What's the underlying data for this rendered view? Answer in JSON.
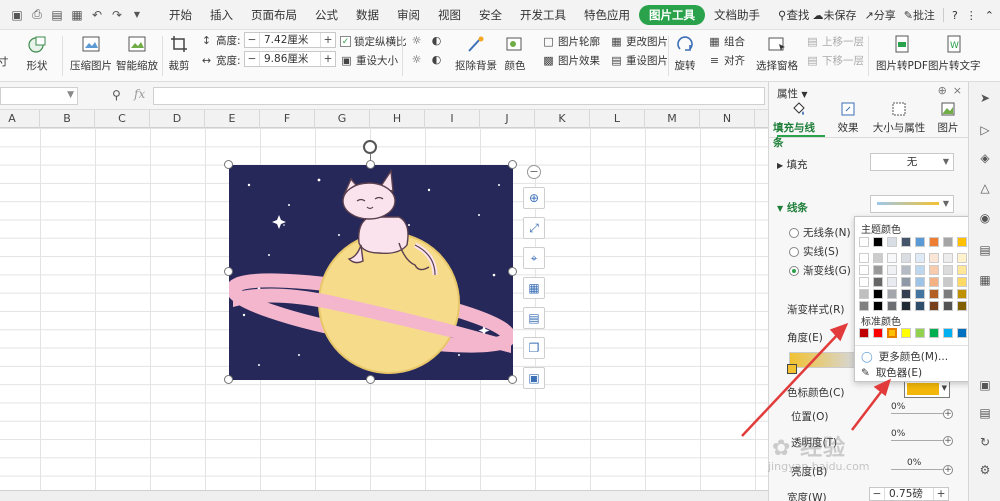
{
  "menubar": {
    "tabs": [
      "开始",
      "插入",
      "页面布局",
      "公式",
      "数据",
      "审阅",
      "视图",
      "安全",
      "开发工具",
      "特色应用",
      "图片工具",
      "文档助手"
    ],
    "active_tab": "图片工具",
    "search": "查找",
    "unsaved": "未保存",
    "share": "分享",
    "comment": "批注"
  },
  "ribbon": {
    "shape": "形状",
    "compress": "压缩图片",
    "smart_scale": "智能缩放",
    "crop": "裁剪",
    "height_label": "高度:",
    "height_value": "7.42厘米",
    "width_label": "宽度:",
    "width_value": "9.86厘米",
    "lock_ratio": "锁定纵横比",
    "reset_size": "重设大小",
    "remove_bg": "抠除背景",
    "color": "颜色",
    "pic_outline": "图片轮廓",
    "pic_effect": "图片效果",
    "change_pic": "更改图片",
    "reset_pic": "重设图片",
    "rotate": "旋转",
    "group": "组合",
    "align": "对齐",
    "select_pane": "选择窗格",
    "up_layer": "上移一层",
    "down_layer": "下移一层",
    "to_pdf": "图片转PDF",
    "to_text": "图片转文字",
    "stub_left": "寸"
  },
  "formula": {
    "fx": "fx"
  },
  "grid": {
    "columns": [
      "A",
      "B",
      "C",
      "D",
      "E",
      "F",
      "G",
      "H",
      "I",
      "J",
      "K",
      "L",
      "M",
      "N"
    ]
  },
  "panel": {
    "title": "属性",
    "tabs": [
      "填充与线条",
      "效果",
      "大小与属性",
      "图片"
    ],
    "fill_label": "填充",
    "fill_value": "无",
    "line_label": "线条",
    "no_line": "无线条(N)",
    "solid_line": "实线(S)",
    "gradient_line": "渐变线(G)",
    "gradient_style": "渐变样式(R)",
    "angle": "角度(E)",
    "stop_color": "色标颜色(C)",
    "position": "位置(O)",
    "transparency": "透明度(T)",
    "brightness": "亮度(B)",
    "width": "宽度(W)",
    "width_value": "0.75磅",
    "pct1": "0%",
    "pct2": "0%",
    "pct3": "0%"
  },
  "color_popup": {
    "theme_header": "主题颜色",
    "standard_header": "标准颜色",
    "more_colors": "更多颜色(M)...",
    "eyedropper": "取色器(E)",
    "theme_top": [
      "#ffffff",
      "#000000",
      "#d9dde4",
      "#44546a",
      "#5b9bd5",
      "#ed7d31",
      "#a5a5a5",
      "#ffc000",
      "#4472c4",
      "#70ad47"
    ],
    "standard": [
      "#c00000",
      "#ff0000",
      "#ffc000",
      "#ffff00",
      "#92d050",
      "#00b050",
      "#00b0f0",
      "#0070c0",
      "#002060",
      "#7030a0"
    ]
  },
  "colors": {
    "accent": "#2aa24b",
    "picture_bg": "#26285a",
    "planet": "#f6dc8a",
    "ring": "#f4b6cc",
    "arrow": "#e23b3b"
  },
  "watermark": "经验",
  "watermark_sub": "jingyan.baidu.com"
}
